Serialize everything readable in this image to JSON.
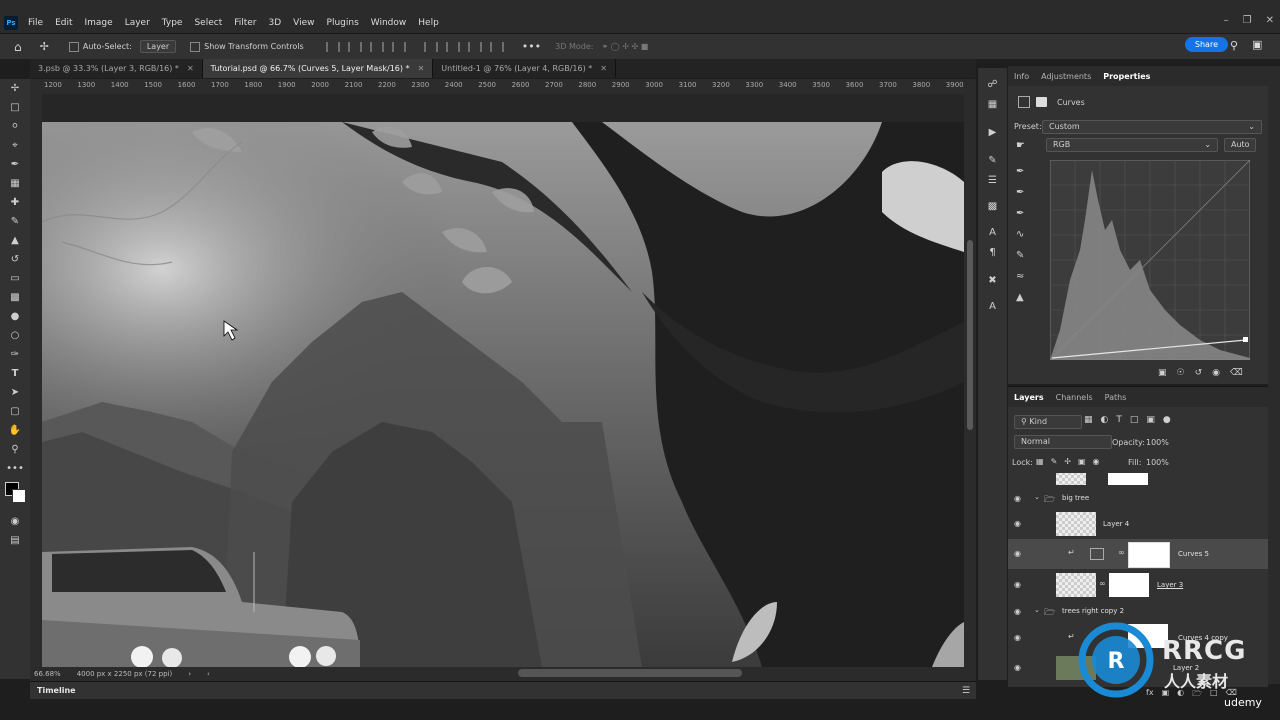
{
  "app": {
    "logo": "Ps"
  },
  "menu": [
    "File",
    "Edit",
    "Image",
    "Layer",
    "Type",
    "Select",
    "Filter",
    "3D",
    "View",
    "Plugins",
    "Window",
    "Help"
  ],
  "options": {
    "auto_select_label": "Auto-Select:",
    "auto_select_value": "Layer",
    "transform_label": "Show Transform Controls",
    "mode_3d": "3D Mode:",
    "share": "Share"
  },
  "tabs": [
    {
      "label": "3.psb @ 33.3% (Layer 3, RGB/16) *",
      "active": false
    },
    {
      "label": "Tutorial.psd @ 66.7% (Curves 5, Layer Mask/16) *",
      "active": true
    },
    {
      "label": "Untitled-1 @ 76% (Layer 4, RGB/16) *",
      "active": false
    }
  ],
  "ruler_ticks": [
    "1200",
    "1300",
    "1400",
    "1500",
    "1600",
    "1700",
    "1800",
    "1900",
    "2000",
    "2100",
    "2200",
    "2300",
    "2400",
    "2500",
    "2600",
    "2700",
    "2800",
    "2900",
    "3000",
    "3100",
    "3200",
    "3300",
    "3400",
    "3500",
    "3600",
    "3700",
    "3800",
    "3900"
  ],
  "status": {
    "zoom": "66.68%",
    "doc_size": "4000 px x 2250 px (72 ppi)"
  },
  "timeline_label": "Timeline",
  "properties": {
    "tabs": [
      "Info",
      "Adjustments",
      "Properties"
    ],
    "active_tab": "Properties",
    "adjustment_name": "Curves",
    "preset_label": "Preset:",
    "preset_value": "Custom",
    "channel_value": "RGB",
    "auto_button": "Auto"
  },
  "layers_panel": {
    "tabs": [
      "Layers",
      "Channels",
      "Paths"
    ],
    "filter_kind": "Kind",
    "blend_mode": "Normal",
    "opacity_label": "Opacity:",
    "opacity_value": "100%",
    "lock_label": "Lock:",
    "fill_label": "Fill:",
    "fill_value": "100%",
    "rows": [
      {
        "name": "big tree",
        "type": "group"
      },
      {
        "name": "Layer 4",
        "type": "layer"
      },
      {
        "name": "Curves 5",
        "type": "adjustment",
        "selected": true
      },
      {
        "name": "Layer 3",
        "type": "layer"
      },
      {
        "name": "trees right copy 2",
        "type": "group"
      },
      {
        "name": "Curves 4 copy",
        "type": "adjustment"
      },
      {
        "name": "Layer 2",
        "type": "layer"
      }
    ]
  },
  "watermark": {
    "brand": "RRCG",
    "sub": "人人素材",
    "site": "udemy"
  },
  "colors": {
    "accent": "#1473e6",
    "panel": "#323232",
    "dark": "#1e1e1e"
  }
}
